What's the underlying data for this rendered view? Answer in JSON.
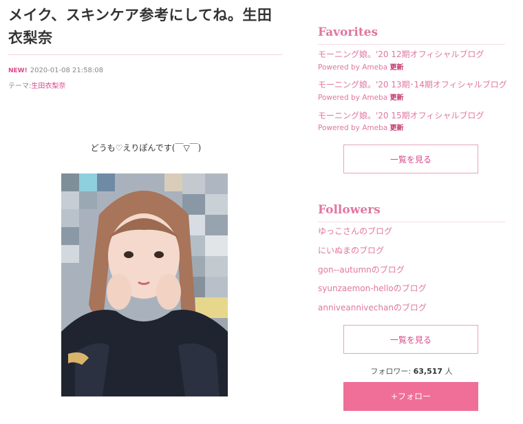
{
  "post": {
    "title_line1": "メイク、スキンケア参考にしてね。生田",
    "title_line2": "衣梨奈",
    "new_badge": "NEW!",
    "datetime": "2020-01-08 21:58:08",
    "theme_label": "テーマ:",
    "theme_link": "生田衣梨奈",
    "greeting": "どうも♡えりぽんです(￣▽￣)"
  },
  "favorites": {
    "heading": "Favorites",
    "items": [
      {
        "title": "モーニング娘。'20 12期オフィシャルブログ",
        "powered": "Powered by Ameba",
        "updated": "更新"
      },
      {
        "title": "モーニング娘。'20 13期･14期オフィシャルブログ",
        "powered": "Powered by Ameba",
        "updated": "更新"
      },
      {
        "title": "モーニング娘。'20 15期オフィシャルブログ",
        "powered": "Powered by Ameba",
        "updated": "更新"
      }
    ],
    "see_all": "一覧を見る"
  },
  "followers": {
    "heading": "Followers",
    "items": [
      "ゆっこさんのブログ",
      "にいぬまのブログ",
      "gon--autumnのブログ",
      "syunzaemon-helloのブログ",
      "anniveannivechanのブログ"
    ],
    "see_all": "一覧を見る",
    "count_label": "フォロワー:",
    "count_value": "63,517",
    "count_unit": "人",
    "follow_button": "+フォロー"
  },
  "colors": {
    "accent": "#e0769f",
    "follow_button": "#ef6f98"
  }
}
